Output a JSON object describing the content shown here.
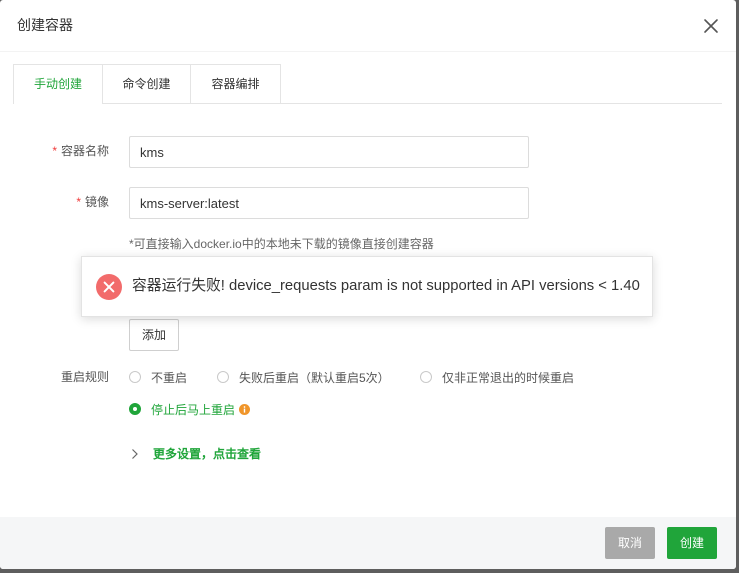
{
  "dialog": {
    "title": "创建容器",
    "close_icon": "close-icon"
  },
  "tabs": [
    {
      "label": "手动创建",
      "active": true
    },
    {
      "label": "命令创建",
      "active": false
    },
    {
      "label": "容器编排",
      "active": false
    }
  ],
  "form": {
    "name": {
      "required_mark": "*",
      "label": "容器名称",
      "value": "kms"
    },
    "image": {
      "required_mark": "*",
      "label": "镜像",
      "value": "kms-server:latest"
    },
    "image_hint": "*可直接输入docker.io中的本地未下载的镜像直接创建容器",
    "add_button": "添加",
    "restart_policy": {
      "label": "重启规则",
      "options": [
        {
          "label": "不重启",
          "selected": false
        },
        {
          "label": "失败后重启（默认重启5次）",
          "selected": false
        },
        {
          "label": "仅非正常退出的时候重启",
          "selected": false
        },
        {
          "label": "停止后马上重启",
          "selected": true,
          "icon": "info-icon"
        }
      ]
    },
    "more_settings": {
      "icon": "chevron-right-icon",
      "label": "更多设置，点击查看"
    }
  },
  "toast": {
    "icon": "error-circle-icon",
    "message": "容器运行失败! device_requests param is not supported in API versions < 1.40"
  },
  "footer": {
    "cancel_label": "取消",
    "create_label": "创建"
  },
  "colors": {
    "accent": "#20a53a",
    "error": "#f26b6b",
    "required": "#f03a3a",
    "warning": "#f0952a",
    "cancel_button": "#a9a9a9"
  }
}
